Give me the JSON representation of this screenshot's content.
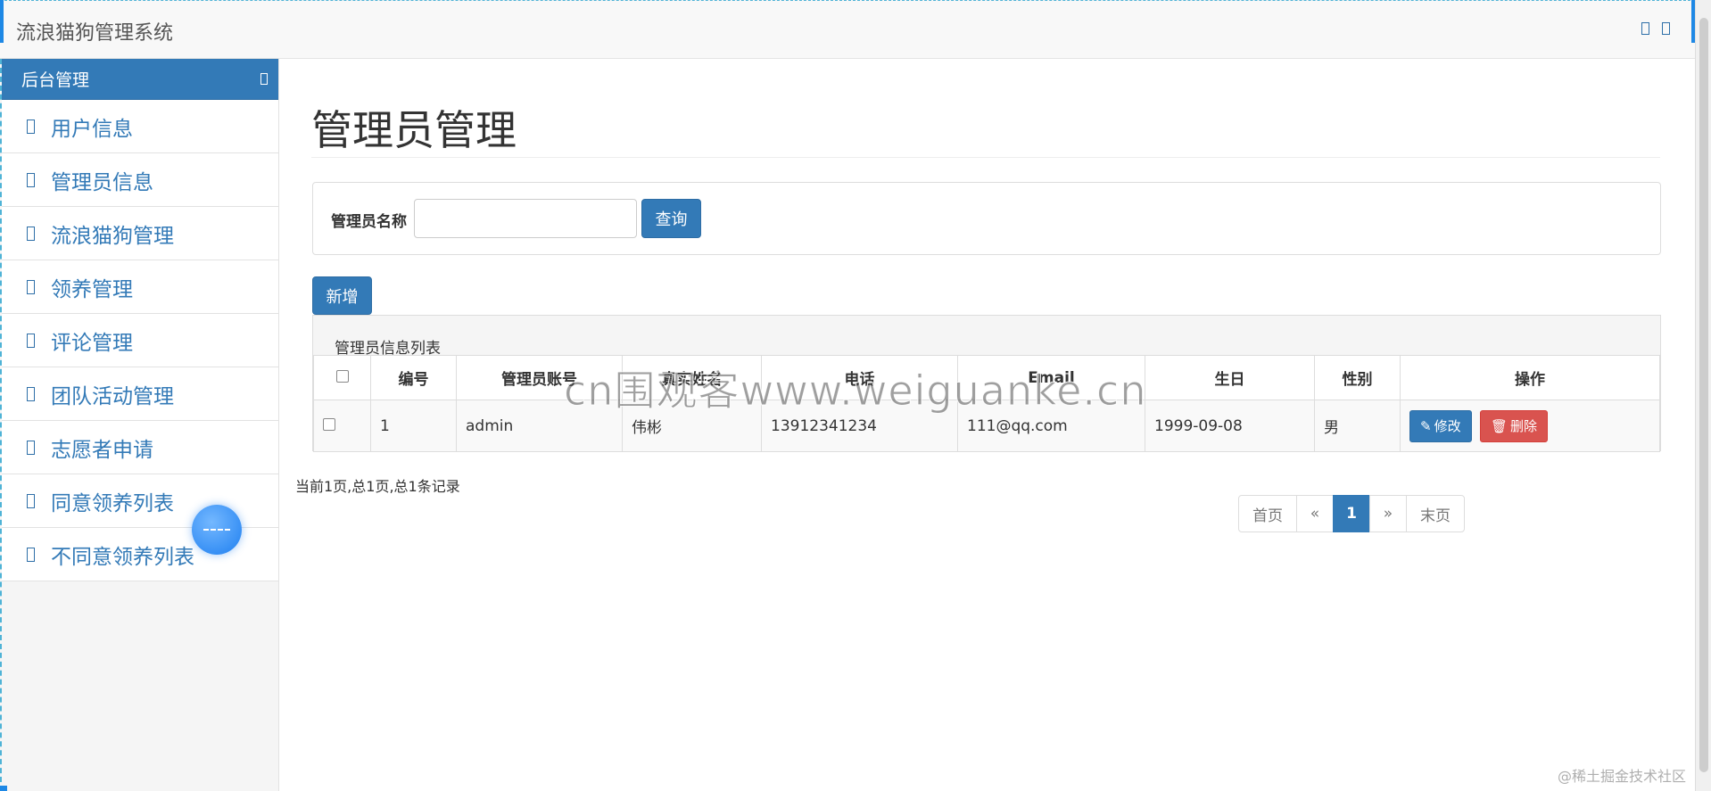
{
  "app": {
    "title": "流浪猫狗管理系统"
  },
  "sidebar": {
    "header": "后台管理",
    "items": [
      {
        "label": "用户信息"
      },
      {
        "label": "管理员信息"
      },
      {
        "label": "流浪猫狗管理"
      },
      {
        "label": "领养管理"
      },
      {
        "label": "评论管理"
      },
      {
        "label": "团队活动管理"
      },
      {
        "label": "志愿者申请"
      },
      {
        "label": "同意领养列表"
      },
      {
        "label": "不同意领养列表"
      }
    ]
  },
  "page": {
    "title": "管理员管理"
  },
  "search": {
    "label": "管理员名称",
    "value": "",
    "button": "查询"
  },
  "toolbar": {
    "add_label": "新增"
  },
  "table": {
    "caption": "管理员信息列表",
    "columns": [
      "编号",
      "管理员账号",
      "真实姓名",
      "电话",
      "Email",
      "生日",
      "性别",
      "操作"
    ],
    "rows": [
      {
        "id": "1",
        "account": "admin",
        "name": "伟彬",
        "phone": "13912341234",
        "email": "111@qq.com",
        "birthday": "1999-09-08",
        "gender": "男"
      }
    ],
    "edit_label": "修改",
    "delete_label": "删除"
  },
  "pager": {
    "info": "当前1页,总1页,总1条记录",
    "first": "首页",
    "prev": "«",
    "current": "1",
    "next": "»",
    "last": "末页"
  },
  "watermark": "cn围观客www.weiguanke.cn",
  "footer_mark": "@稀土掘金技术社区",
  "colors": {
    "primary": "#337ab7",
    "danger": "#d9534f",
    "link": "#337ab7"
  }
}
